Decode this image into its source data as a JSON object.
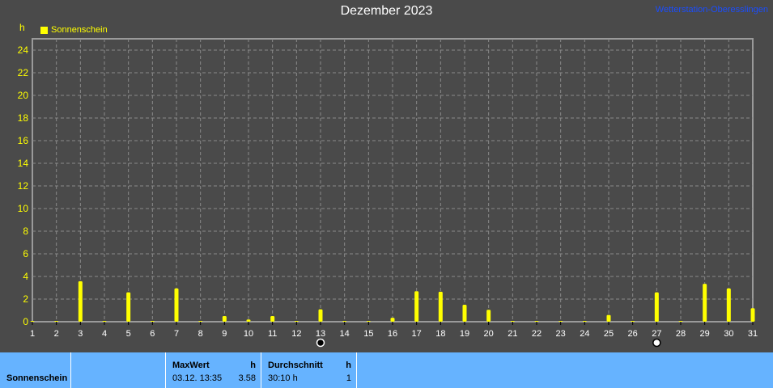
{
  "title": "Dezember 2023",
  "station": "Wetterstation-Oberesslingen",
  "legend_label": "Sonnenschein",
  "colors": {
    "background": "#4a4a4a",
    "bar": "#ffff00",
    "grid": "#8a8a8a",
    "axis_text": "#ffff00",
    "panel": "#66b3ff"
  },
  "chart_data": {
    "type": "bar",
    "ylabel": "h",
    "ylim": [
      0,
      25
    ],
    "yticks": [
      0,
      2,
      4,
      6,
      8,
      10,
      12,
      14,
      16,
      18,
      20,
      22,
      24
    ],
    "categories": [
      "1",
      "2",
      "3",
      "4",
      "5",
      "6",
      "7",
      "8",
      "9",
      "10",
      "11",
      "12",
      "13",
      "14",
      "15",
      "16",
      "17",
      "18",
      "19",
      "20",
      "21",
      "22",
      "23",
      "24",
      "25",
      "26",
      "27",
      "28",
      "29",
      "30",
      "31"
    ],
    "series": [
      {
        "name": "Sonnenschein",
        "values": [
          0.05,
          0.05,
          3.58,
          0.05,
          2.6,
          0.05,
          2.95,
          0.05,
          0.5,
          0.2,
          0.5,
          0.05,
          1.1,
          0.05,
          0.05,
          0.35,
          2.7,
          2.65,
          1.5,
          1.05,
          0.05,
          0.05,
          0.05,
          0.05,
          0.6,
          0.05,
          2.6,
          0.05,
          3.35,
          2.95,
          1.2
        ]
      }
    ],
    "grid": true,
    "legend": "top-left"
  },
  "footer": {
    "row_label": "Sonnenschein",
    "max_header": "MaxWert",
    "max_unit": "h",
    "max_time": "03.12.  13:35",
    "max_value": "3.58",
    "avg_header": "Durchschnitt",
    "avg_unit": "h",
    "avg_value": "30:10 h",
    "avg_count": "1"
  }
}
